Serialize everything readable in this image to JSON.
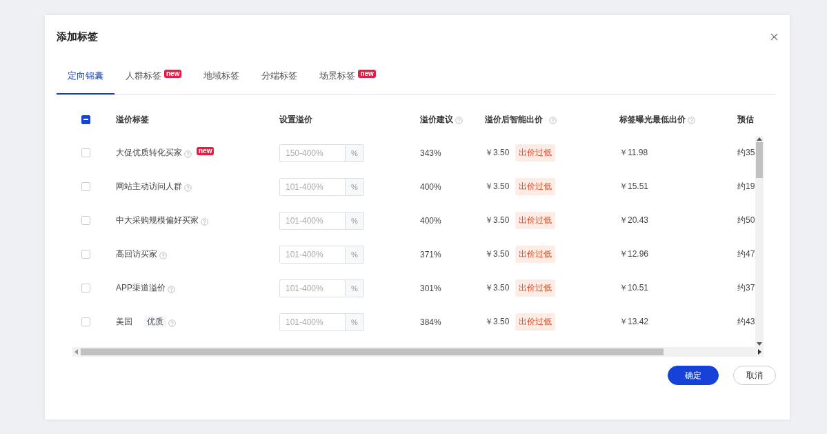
{
  "dialog": {
    "title": "添加标签"
  },
  "tabs": [
    {
      "label": "定向锦囊",
      "selected": true
    },
    {
      "label": "人群标签",
      "selected": false,
      "badge": "new"
    },
    {
      "label": "地域标签",
      "selected": false
    },
    {
      "label": "分端标签",
      "selected": false
    },
    {
      "label": "场景标签",
      "selected": false,
      "badge": "new"
    }
  ],
  "table": {
    "select_all": {
      "indeterminate": true
    },
    "columns": [
      {
        "label": "溢价标签",
        "help": false
      },
      {
        "label": "设置溢价",
        "help": false
      },
      {
        "label": "溢价建议",
        "help": true
      },
      {
        "label": "溢价后智能出价",
        "help": true
      },
      {
        "label": "标签曝光最低出价",
        "help": true
      },
      {
        "label": "预估",
        "help": false
      }
    ],
    "rows": [
      {
        "checked": false,
        "name": "大促优质转化买家",
        "badge": "new",
        "placeholder": "150-400%",
        "unit": "%",
        "suggestion": "343%",
        "smart_bid": "￥3.50",
        "status": "出价过低",
        "min_bid": "￥11.98",
        "estimate": "约35"
      },
      {
        "checked": false,
        "name": "网站主动访问人群",
        "placeholder": "101-400%",
        "unit": "%",
        "suggestion": "400%",
        "smart_bid": "￥3.50",
        "status": "出价过低",
        "min_bid": "￥15.51",
        "estimate": "约19"
      },
      {
        "checked": false,
        "name": "中大采购规模偏好买家",
        "placeholder": "101-400%",
        "unit": "%",
        "suggestion": "400%",
        "smart_bid": "￥3.50",
        "status": "出价过低",
        "min_bid": "￥20.43",
        "estimate": "约50"
      },
      {
        "checked": false,
        "name": "高回访买家",
        "placeholder": "101-400%",
        "unit": "%",
        "suggestion": "371%",
        "smart_bid": "￥3.50",
        "status": "出价过低",
        "min_bid": "￥12.96",
        "estimate": "约47"
      },
      {
        "checked": false,
        "name": "APP渠道溢价",
        "placeholder": "101-400%",
        "unit": "%",
        "suggestion": "301%",
        "smart_bid": "￥3.50",
        "status": "出价过低",
        "min_bid": "￥10.51",
        "estimate": "约37"
      },
      {
        "checked": false,
        "name": "美国",
        "tag": "优质",
        "placeholder": "101-400%",
        "unit": "%",
        "suggestion": "384%",
        "smart_bid": "￥3.50",
        "status": "出价过低",
        "min_bid": "￥13.42",
        "estimate": "约43"
      }
    ]
  },
  "buttons": [
    {
      "label": "确定",
      "kind": "primary"
    },
    {
      "label": "取消",
      "kind": "default"
    }
  ]
}
